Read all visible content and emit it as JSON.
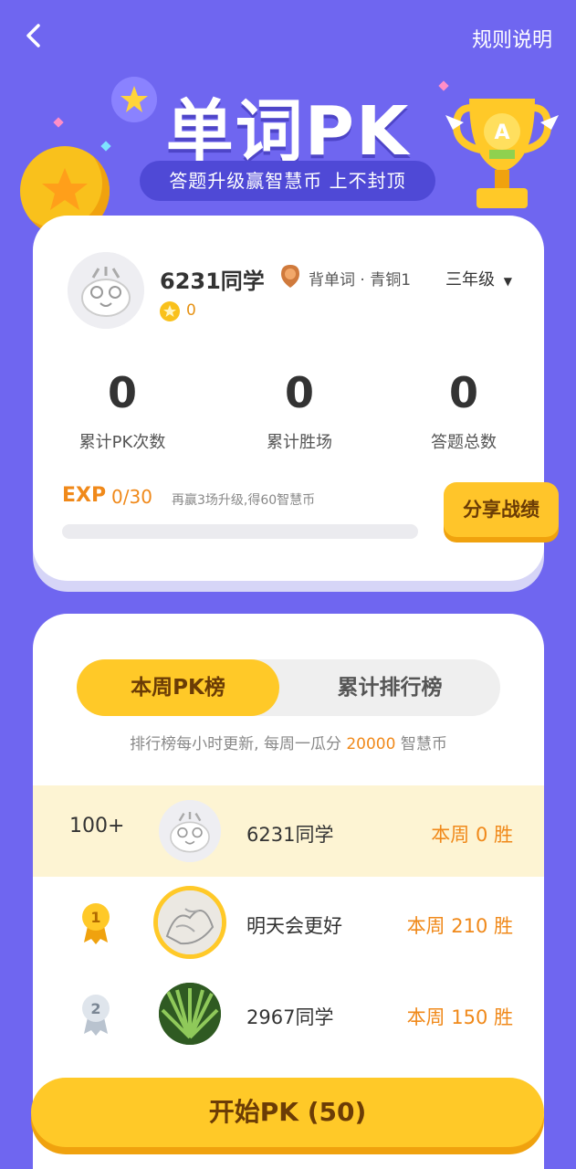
{
  "header": {
    "back_icon": "chevron-left-icon",
    "rules_label": "规则说明"
  },
  "hero": {
    "title": "单词PK",
    "subtitle": "答题升级赢智慧币 上不封顶"
  },
  "profile": {
    "name": "6231同学",
    "level_text": "背单词 · 青铜1",
    "grade": "三年级",
    "coins": "0",
    "stats": [
      {
        "value": "0",
        "label": "累计PK次数"
      },
      {
        "value": "0",
        "label": "累计胜场"
      },
      {
        "value": "0",
        "label": "答题总数"
      }
    ],
    "exp_label": "EXP",
    "exp_value": "0/30",
    "exp_progress": 0,
    "exp_hint": "再赢3场升级,得60智慧币",
    "share_label": "分享战绩"
  },
  "ranking": {
    "tabs": [
      {
        "label": "本周PK榜",
        "active": true
      },
      {
        "label": "累计排行榜",
        "active": false
      }
    ],
    "note_prefix": "排行榜每小时更新, 每周一瓜分 ",
    "note_amount": "20000",
    "note_suffix": " 智慧币",
    "rows": [
      {
        "rank": "100+",
        "name": "6231同学",
        "wins": "本周 0 胜",
        "is_me": true
      },
      {
        "rank": "1",
        "name": "明天会更好",
        "wins": "本周 210 胜"
      },
      {
        "rank": "2",
        "name": "2967同学",
        "wins": "本周 150 胜"
      }
    ]
  },
  "start_button": "开始PK (50)",
  "colors": {
    "background": "#6f66f0",
    "accent": "#ffc928",
    "accent_text": "#6b3c06",
    "orange": "#f0891a"
  }
}
